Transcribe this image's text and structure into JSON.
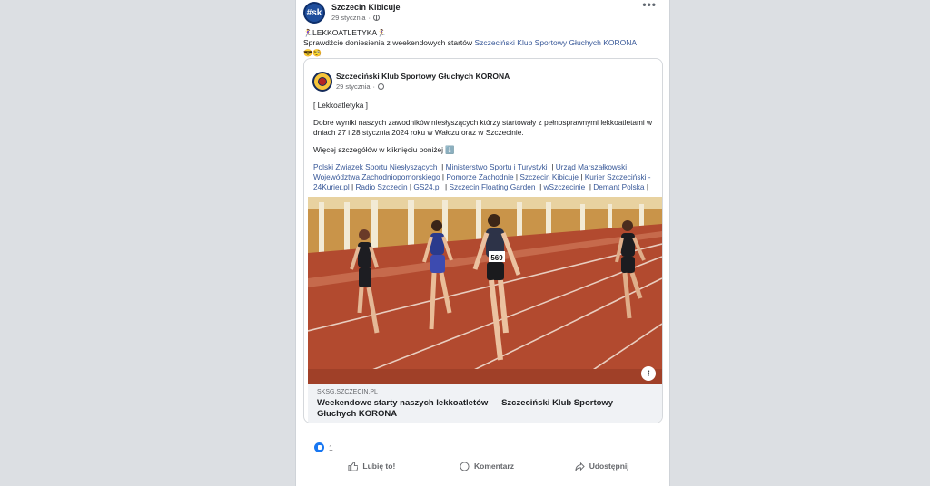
{
  "post": {
    "author": "Szczecin Kibicuje",
    "avatar_text": "#sk",
    "date": "29 stycznia",
    "more_label": "•••",
    "text_line1": "LEKKOATLETYKA",
    "text_line2_prefix": "Sprawdźcie doniesienia z weekendowych startów ",
    "text_line2_link": "Szczeciński Klub Sportowy Głuchych KORONA",
    "emojis": "😎🧐",
    "emoji_runner": "🏃‍♀️"
  },
  "shared": {
    "author": "Szczeciński Klub Sportowy Głuchych KORONA",
    "date": "29 stycznia",
    "tag": "[ Lekkoatletyka ]",
    "body": "Dobre wyniki naszych zawodników niesłyszących którzy startowały z pełnosprawnymi lekkoatletami w dniach 27 i 28 stycznia 2024 roku w Wałczu oraz w Szczecinie.",
    "more_info": "Więcej szczegółów w kliknięciu poniżej ⬇️",
    "partners": [
      "Polski Związek Sportu Niesłyszących",
      "Ministerstwo Sportu i Turystyki",
      "Urząd Marszałkowski Województwa Zachodniopomorskiego",
      "Pomorze Zachodnie",
      "Szczecin Kibicuje",
      "Kurier Szczeciński - 24Kurier.pl",
      "Radio Szczecin",
      "GS24.pl",
      "Szczecin Floating Garden",
      "wSzczecinie",
      "Demant Polska"
    ],
    "bib_number": "569",
    "info_icon": "i"
  },
  "link_card": {
    "domain": "sksg.szczecin.pl",
    "title": "Weekendowe starty naszych lekkoatletów — Szczeciński Klub Sportowy Głuchych KORONA"
  },
  "reactions": {
    "count": "1"
  },
  "actions": {
    "like": "Lubię to!",
    "comment": "Komentarz",
    "share": "Udostępnij"
  },
  "icons": {
    "like": "thumbs-up-icon",
    "comment": "speech-bubble-icon",
    "share": "share-arrow-icon",
    "privacy": "globe-icon"
  },
  "colors": {
    "link": "#385898",
    "like_blue": "#1877f2",
    "track": "#b24a2f"
  }
}
